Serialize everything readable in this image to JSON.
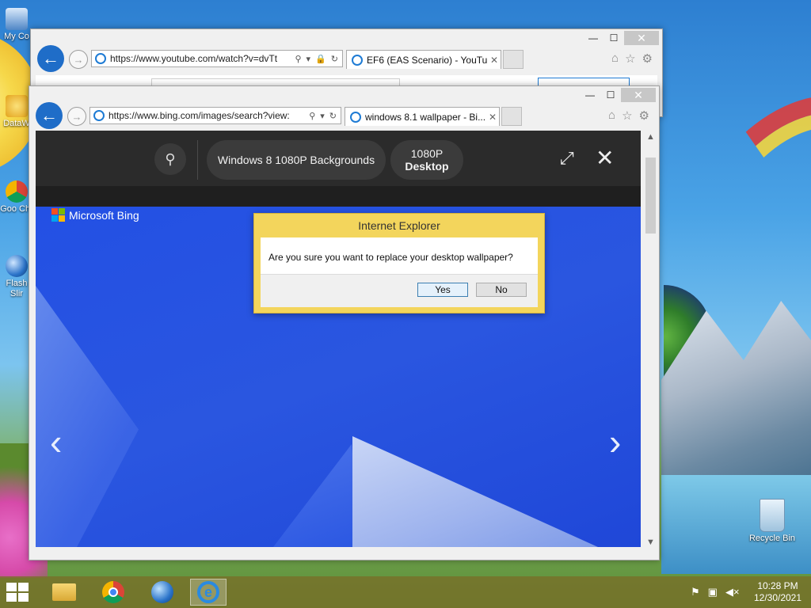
{
  "desktop": {
    "icons": [
      {
        "label": "My Co"
      },
      {
        "label": "DataW"
      },
      {
        "label": "Goo Chr"
      },
      {
        "label": "Flash Slir"
      }
    ],
    "recycle_bin": "Recycle Bin"
  },
  "back_window": {
    "address": "https://www.youtube.com/watch?v=dvTt",
    "tab_title": "EF6 (EAS Scenario) - YouTu...",
    "tab_close": "✕"
  },
  "front_window": {
    "address": "https://www.bing.com/images/search?view:",
    "tab_title": "windows 8.1 wallpaper - Bi...",
    "tab_close": "✕"
  },
  "caption": {
    "minimize": "—",
    "maximize": "☐",
    "close": "✕"
  },
  "bing": {
    "related_1": "Windows 8 1080P Backgrounds",
    "related_2_line1": "1080P",
    "related_2_line2": "Desktop",
    "brand": "Microsoft Bing",
    "logo_colors": [
      "#f25022",
      "#7fba00",
      "#00a4ef",
      "#ffb900"
    ]
  },
  "dialog": {
    "title": "Internet Explorer",
    "message": "Are you sure you want to replace your desktop wallpaper?",
    "yes": "Yes",
    "no": "No"
  },
  "taskbar": {
    "time": "10:28 PM",
    "date": "12/30/2021",
    "apps": [
      "file-explorer",
      "chrome",
      "globe",
      "internet-explorer"
    ]
  }
}
